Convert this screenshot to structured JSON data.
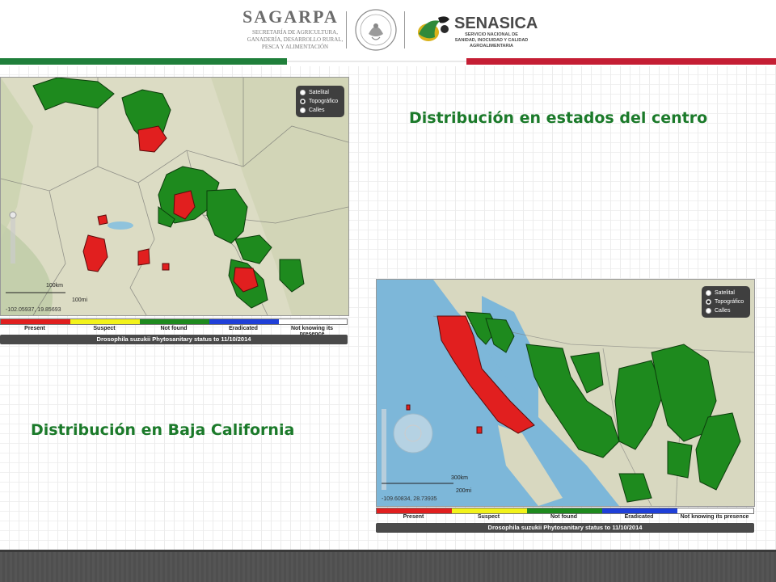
{
  "header": {
    "sagarpa_logo": "SAGARPA",
    "sagarpa_sub": "SECRETARÍA DE AGRICULTURA, GANADERÍA, DESARROLLO RURAL, PESCA Y ALIMENTACIÓN",
    "seal_text": "ESTADOS UNIDOS MEXICANOS",
    "senasica_logo": "SENASICA",
    "senasica_sub": "SERVICIO NACIONAL DE SANIDAD, INOCUIDAD Y CALIDAD AGROALIMENTARIA"
  },
  "titles": {
    "center": "Distribución en estados del centro",
    "baja": "Distribución en Baja California"
  },
  "map_center": {
    "layers": [
      "Satelital",
      "Topográfico",
      "Calles"
    ],
    "selected_layer": "Topográfico",
    "coords": "-102.05937, 19.85693",
    "scale_km": "100km",
    "scale_mi": "100mi"
  },
  "map_baja": {
    "layers": [
      "Satelital",
      "Topográfico",
      "Calles"
    ],
    "selected_layer": "Topográfico",
    "coords": "-109.60834, 28.73935",
    "scale_km": "300km",
    "scale_mi": "200mi"
  },
  "legend": {
    "items": [
      {
        "label": "Present",
        "color": "#e11f1f"
      },
      {
        "label": "Suspect",
        "color": "#f2f21a"
      },
      {
        "label": "Not found",
        "color": "#1e8a1e"
      },
      {
        "label": "Eradicated",
        "color": "#1f3fd8"
      },
      {
        "label": "Not knowing its presence",
        "color": "#ffffff"
      }
    ],
    "caption": "Drosophila suzukii Phytosanitary status to 11/10/2014"
  },
  "colors": {
    "brand_green": "#1b7a2a",
    "brand_red": "#c51e34",
    "present": "#e11f1f",
    "not_found": "#1e8a1e",
    "sea": "#7fb8d8",
    "land": "#dcdcc0"
  }
}
